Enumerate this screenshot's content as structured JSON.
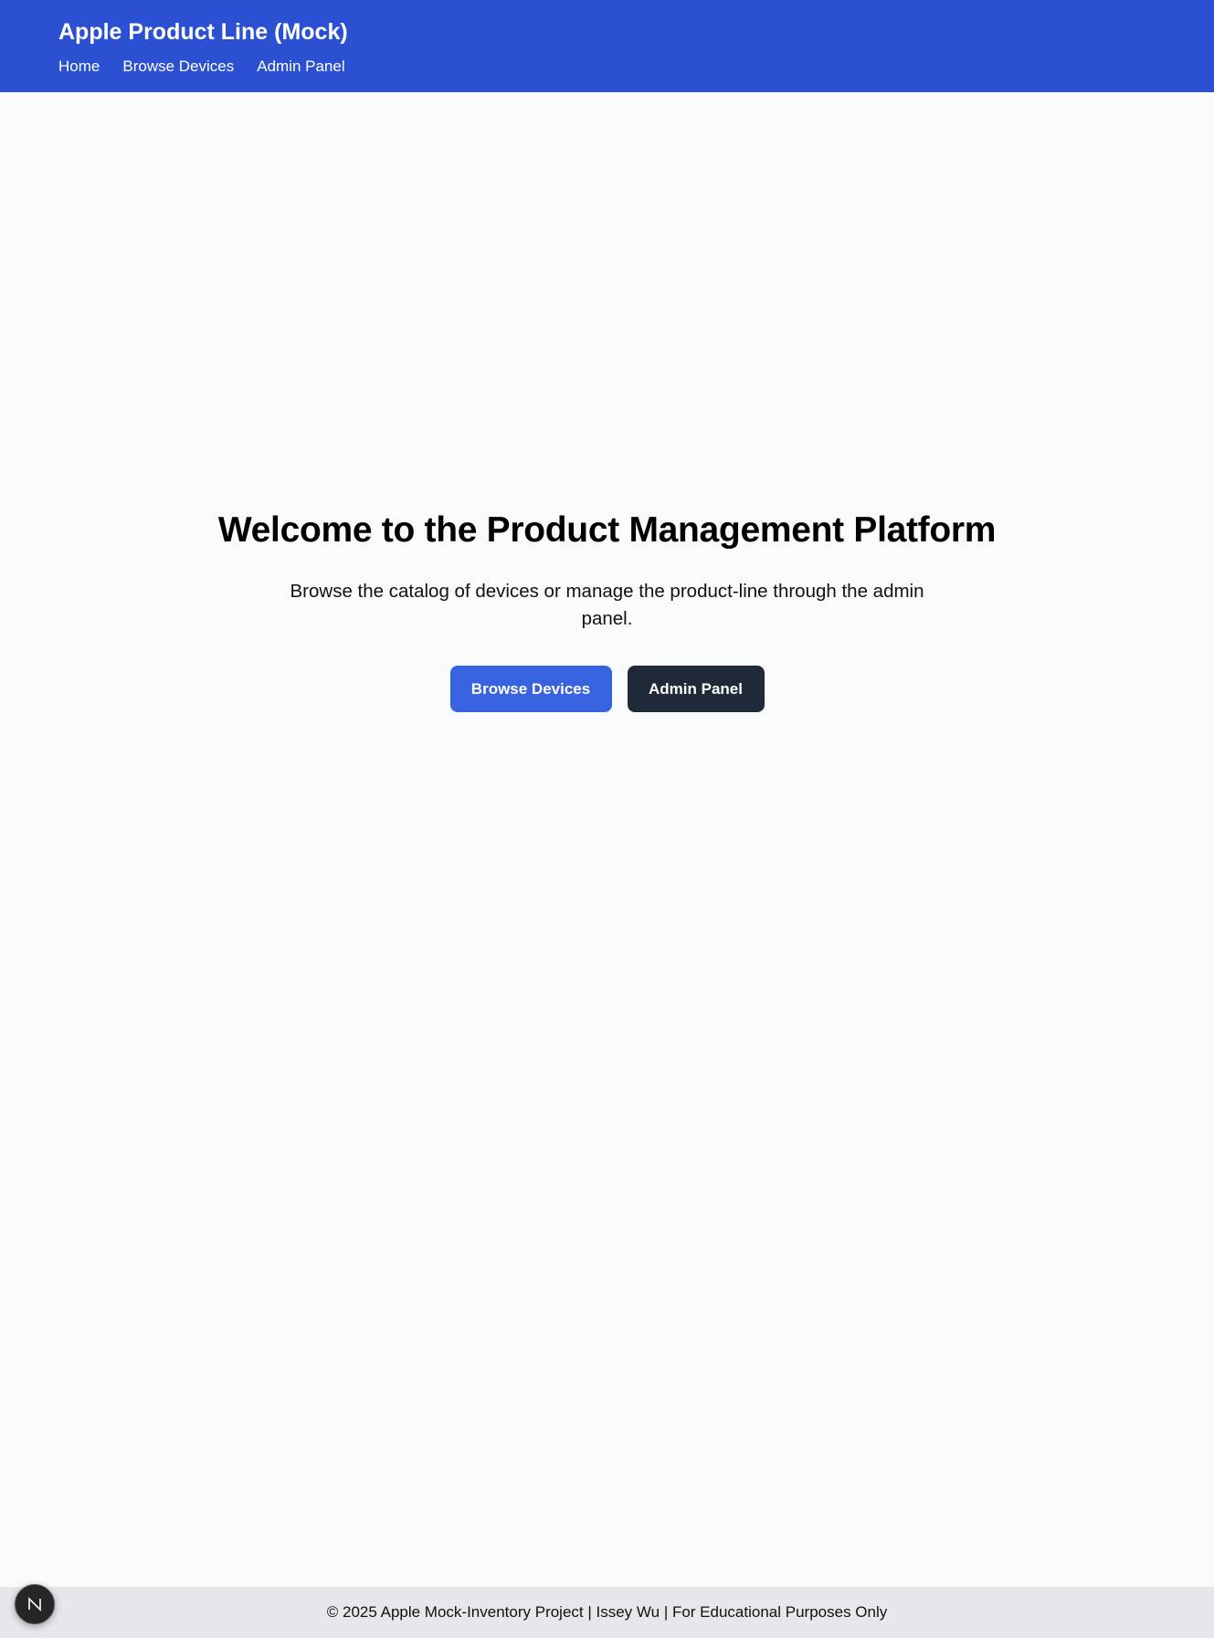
{
  "header": {
    "title": "Apple Product Line (Mock)",
    "nav": [
      "Home",
      "Browse Devices",
      "Admin Panel"
    ]
  },
  "hero": {
    "heading": "Welcome to the Product Management Platform",
    "subtitle": "Browse the catalog of devices or manage the product-line through the admin panel.",
    "primary_button": "Browse Devices",
    "secondary_button": "Admin Panel"
  },
  "footer": {
    "text": "© 2025 Apple Mock-Inventory Project | Issey Wu | For Educational Purposes Only"
  },
  "dev_badge": {
    "icon": "next-js-logo-icon"
  },
  "colors": {
    "header_bg": "#2b50d2",
    "primary_button": "#3762e0",
    "dark_button": "#1f2937",
    "page_bg": "#f8fafc",
    "footer_bg": "#e5e7eb"
  }
}
